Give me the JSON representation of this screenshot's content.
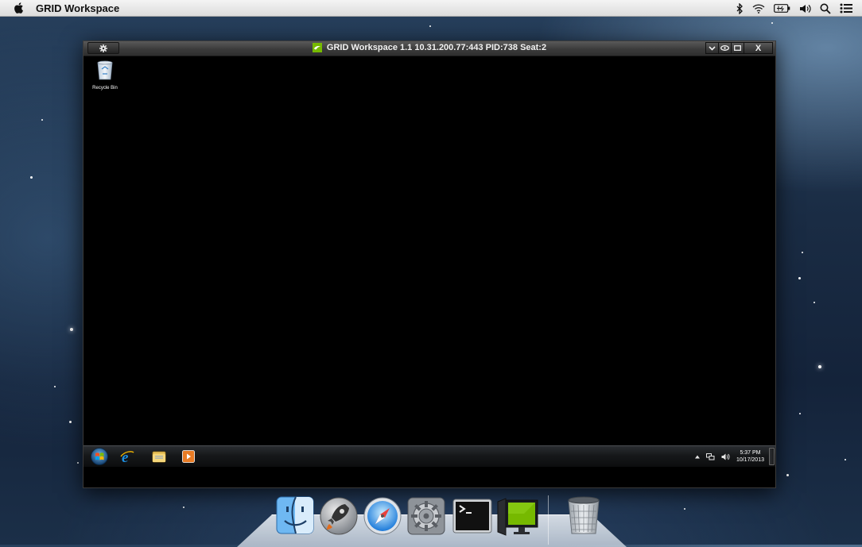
{
  "menubar": {
    "app_name": "GRID Workspace",
    "status_icons": [
      "bluetooth-icon",
      "wifi-icon",
      "battery-icon",
      "volume-icon",
      "spotlight-search-icon",
      "notification-center-icon"
    ]
  },
  "grid_window": {
    "title": "GRID Workspace 1.1 10.31.200.77:443 PID:738 Seat:2",
    "controls": [
      "gear-icon",
      "chevron-down-icon",
      "eye-icon",
      "maximize-icon",
      "close-icon"
    ],
    "close_label": "X"
  },
  "remote_desktop": {
    "icons": [
      {
        "label": "Recycle Bin",
        "icon": "recycle-bin-icon"
      }
    ],
    "taskbar": {
      "pinned": [
        "start-orb-icon",
        "internet-explorer-icon",
        "file-explorer-icon",
        "media-player-icon"
      ],
      "tray_icons": [
        "show-hidden-icons-icon",
        "network-icon",
        "volume-icon"
      ],
      "clock": {
        "time": "5:37 PM",
        "date": "10/17/2013"
      }
    }
  },
  "dock": {
    "items": [
      "finder-icon",
      "launchpad-icon",
      "safari-icon",
      "system-preferences-icon",
      "terminal-icon",
      "grid-workspace-icon",
      "trash-icon"
    ]
  },
  "colors": {
    "nvidia_green": "#76b900",
    "titlebar": "#3b3b3b",
    "remote_background": "#000000"
  }
}
